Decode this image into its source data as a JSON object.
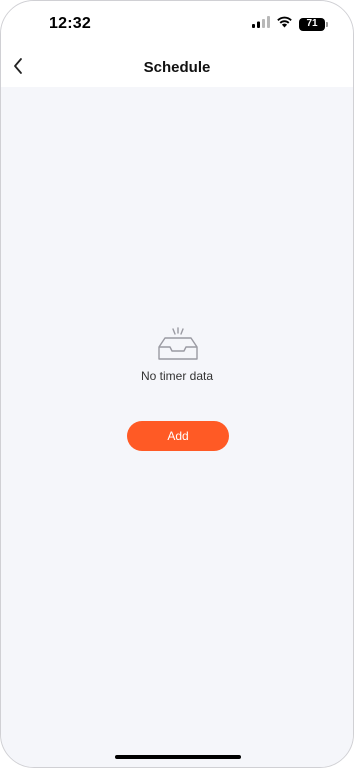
{
  "status_bar": {
    "time": "12:32",
    "battery_level": "71",
    "icons": [
      "signal-icon",
      "wifi-icon",
      "battery-icon"
    ]
  },
  "header": {
    "title": "Schedule",
    "back_icon": "chevron-left-icon"
  },
  "empty_state": {
    "icon": "empty-inbox-icon",
    "message": "No timer data"
  },
  "actions": {
    "add_label": "Add"
  },
  "colors": {
    "accent": "#ff5a25",
    "background": "#f5f6fa",
    "header_background": "#ffffff",
    "icon_gray": "#9a9aa2"
  }
}
